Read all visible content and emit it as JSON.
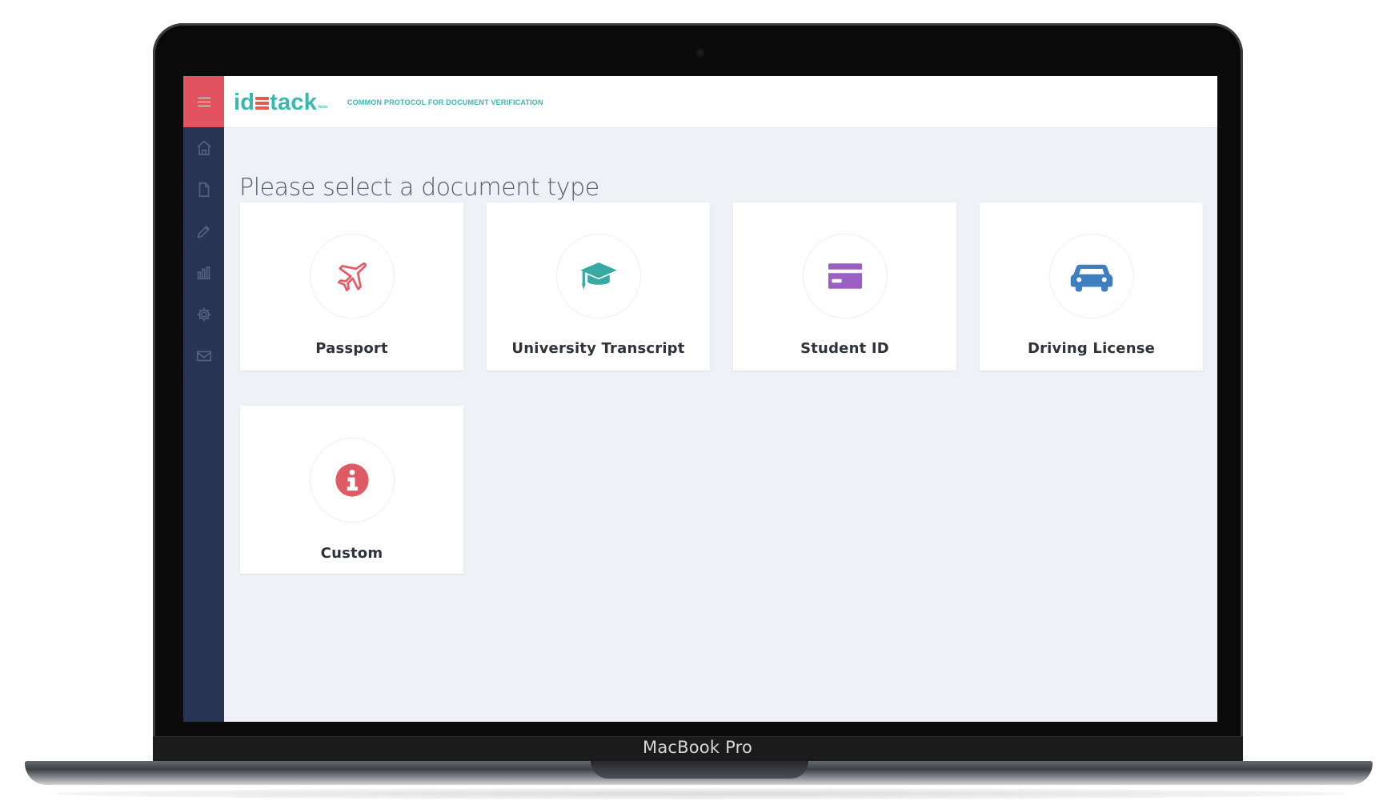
{
  "device": {
    "label": "MacBook Pro"
  },
  "app": {
    "brand": {
      "prefix": "id",
      "suffix": "tack",
      "small_mark": "beta",
      "tagline": "COMMON PROTOCOL FOR DOCUMENT VERIFICATION",
      "primary_color": "#3ab7af",
      "accent_color": "#e35a4e"
    },
    "sidebar": {
      "background": "#283454",
      "menu_color": "#e25360",
      "items": [
        {
          "icon": "home-icon"
        },
        {
          "icon": "document-icon"
        },
        {
          "icon": "pencil-icon"
        },
        {
          "icon": "chart-icon"
        },
        {
          "icon": "gear-icon"
        },
        {
          "icon": "mail-icon"
        }
      ]
    },
    "main": {
      "title": "Please select a document type",
      "cards": [
        {
          "label": "Passport",
          "icon": "airplane-icon",
          "color": "#e15d68"
        },
        {
          "label": "University Transcript",
          "icon": "graduation-cap-icon",
          "color": "#37aaa4"
        },
        {
          "label": "Student ID",
          "icon": "id-card-icon",
          "color": "#9a5fc0"
        },
        {
          "label": "Driving License",
          "icon": "car-icon",
          "color": "#3e7fc1"
        },
        {
          "label": "Custom",
          "icon": "info-icon",
          "color": "#df5b63"
        }
      ]
    }
  }
}
